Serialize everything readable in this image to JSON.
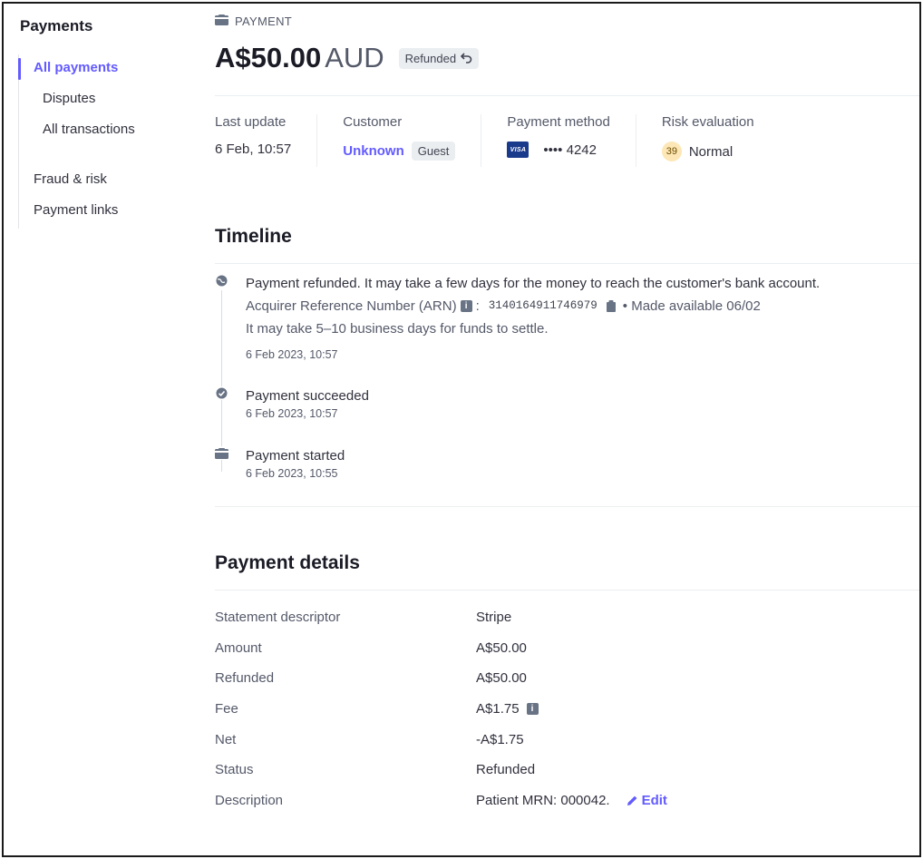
{
  "sidebar": {
    "title": "Payments",
    "items": [
      {
        "label": "All payments"
      },
      {
        "label": "Disputes"
      },
      {
        "label": "All transactions"
      },
      {
        "label": "Fraud & risk"
      },
      {
        "label": "Payment links"
      }
    ]
  },
  "header": {
    "crumb": "PAYMENT",
    "amount": "A$50.00",
    "currency": "AUD",
    "status_badge": "Refunded"
  },
  "summary": {
    "last_update_label": "Last update",
    "last_update_value": "6 Feb, 10:57",
    "customer_label": "Customer",
    "customer_value": "Unknown",
    "customer_tag": "Guest",
    "payment_method_label": "Payment method",
    "card_brand": "VISA",
    "card_last4": "•••• 4242",
    "risk_label": "Risk evaluation",
    "risk_score": "39",
    "risk_value": "Normal"
  },
  "timeline": {
    "title": "Timeline",
    "events": [
      {
        "text": "Payment refunded. It may take a few days for the money to reach the customer's bank account.",
        "arn_label": "Acquirer Reference Number (ARN)",
        "arn_value": "3140164911746979",
        "available": "• Made available 06/02",
        "note": "It may take 5–10 business days for funds to settle.",
        "date": "6 Feb 2023, 10:57"
      },
      {
        "text": "Payment succeeded",
        "date": "6 Feb 2023, 10:57"
      },
      {
        "text": "Payment started",
        "date": "6 Feb 2023, 10:55"
      }
    ]
  },
  "details": {
    "title": "Payment details",
    "rows": [
      {
        "label": "Statement descriptor",
        "value": "Stripe"
      },
      {
        "label": "Amount",
        "value": "A$50.00"
      },
      {
        "label": "Refunded",
        "value": "A$50.00"
      },
      {
        "label": "Fee",
        "value": "A$1.75"
      },
      {
        "label": "Net",
        "value": "-A$1.75"
      },
      {
        "label": "Status",
        "value": "Refunded"
      },
      {
        "label": "Description",
        "value": "Patient MRN: 000042."
      }
    ],
    "edit_label": "Edit"
  },
  "colors": {
    "accent": "#635bff",
    "text": "#30313d",
    "muted": "#545969"
  }
}
